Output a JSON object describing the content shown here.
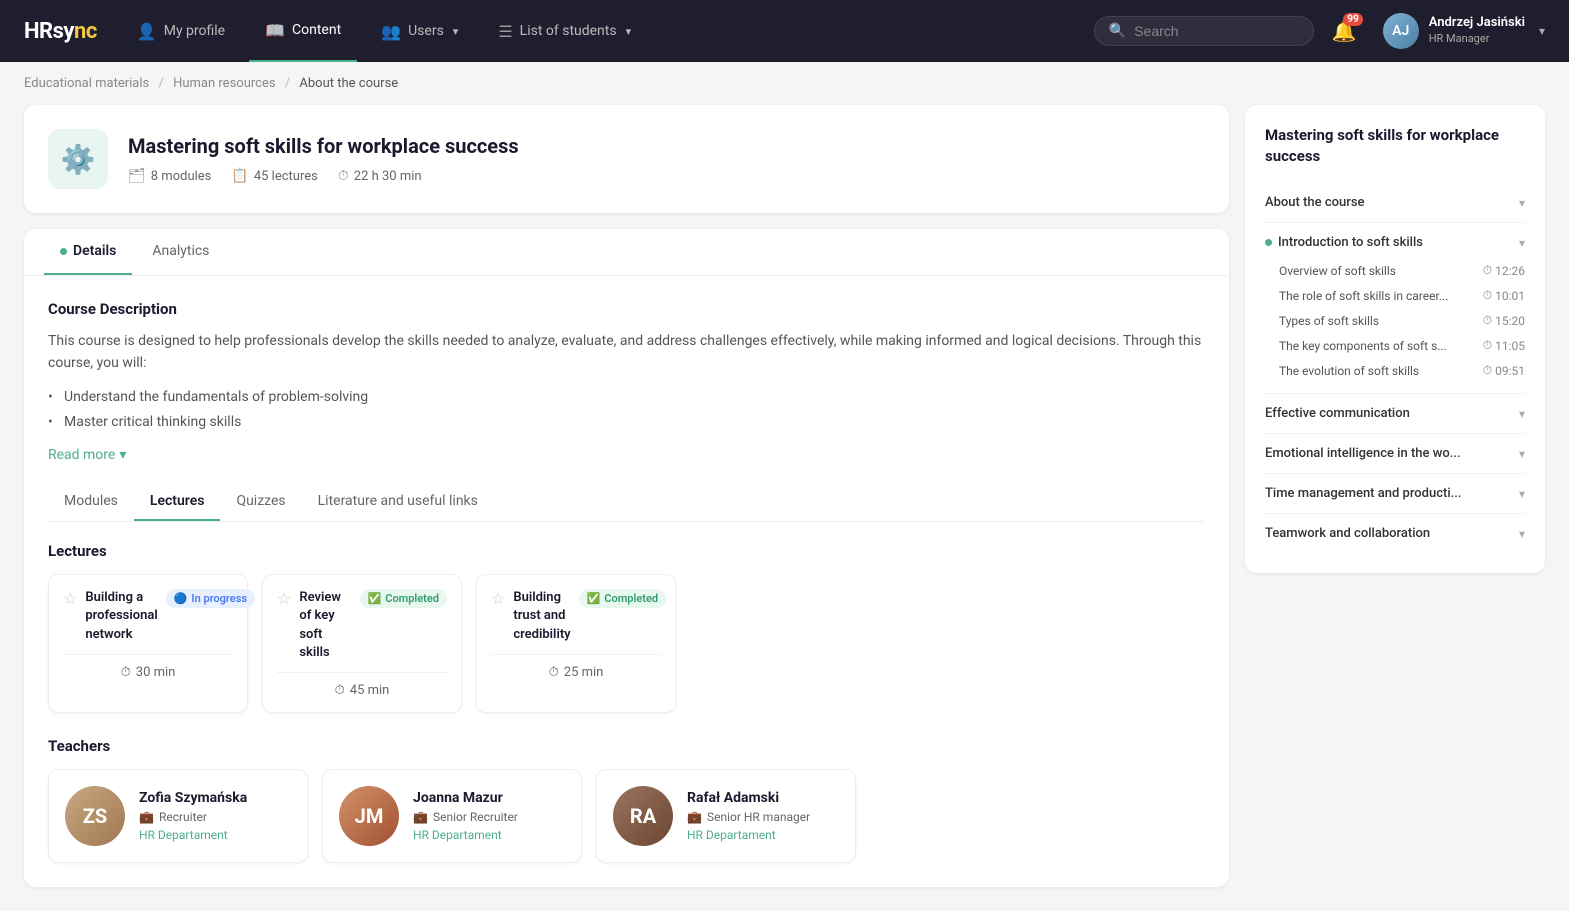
{
  "app": {
    "logo_text": "HRsy",
    "logo_accent": "nc"
  },
  "navbar": {
    "items": [
      {
        "id": "my-profile",
        "label": "My profile",
        "icon": "👤",
        "active": false
      },
      {
        "id": "content",
        "label": "Content",
        "icon": "📖",
        "active": true
      },
      {
        "id": "users",
        "label": "Users",
        "icon": "👥",
        "active": false,
        "has_dropdown": true
      },
      {
        "id": "list-of-students",
        "label": "List of students",
        "icon": "☰",
        "active": false,
        "has_dropdown": true
      }
    ],
    "search_placeholder": "Search",
    "notification_count": "99",
    "user": {
      "name": "Andrzej Jasiński",
      "role": "HR Manager"
    }
  },
  "breadcrumb": {
    "items": [
      {
        "label": "Educational materials"
      },
      {
        "label": "Human resources"
      },
      {
        "label": "About the course"
      }
    ]
  },
  "course": {
    "icon": "⚙️",
    "title": "Mastering soft skills for workplace success",
    "modules": "8 modules",
    "lectures": "45 lectures",
    "duration": "22 h 30 min"
  },
  "tabs": {
    "items": [
      {
        "id": "details",
        "label": "Details",
        "active": true,
        "has_dot": true
      },
      {
        "id": "analytics",
        "label": "Analytics",
        "active": false,
        "has_dot": false
      }
    ]
  },
  "description": {
    "section_title": "Course Description",
    "text": "This course is designed to help professionals develop the skills needed to analyze, evaluate, and address challenges effectively, while making informed and logical decisions. Through this course, you will:",
    "bullets": [
      "Understand the fundamentals of problem-solving",
      "Master critical thinking skills"
    ],
    "read_more_label": "Read more"
  },
  "sub_tabs": {
    "items": [
      {
        "id": "modules",
        "label": "Modules",
        "active": false
      },
      {
        "id": "lectures",
        "label": "Lectures",
        "active": true
      },
      {
        "id": "quizzes",
        "label": "Quizzes",
        "active": false
      },
      {
        "id": "literature",
        "label": "Literature and useful links",
        "active": false
      }
    ]
  },
  "lectures_section": {
    "title": "Lectures",
    "items": [
      {
        "id": "lec1",
        "name": "Building a professional network",
        "badge_label": "In progress",
        "badge_type": "inprogress",
        "badge_icon": "🔵",
        "time": "30 min"
      },
      {
        "id": "lec2",
        "name": "Review of key soft skills",
        "badge_label": "Completed",
        "badge_type": "completed",
        "badge_icon": "✅",
        "time": "45 min"
      },
      {
        "id": "lec3",
        "name": "Building trust and credibility",
        "badge_label": "Completed",
        "badge_type": "completed",
        "badge_icon": "✅",
        "time": "25 min"
      }
    ]
  },
  "teachers_section": {
    "title": "Teachers",
    "items": [
      {
        "id": "t1",
        "name": "Zofia Szymańska",
        "role": "Recruiter",
        "dept": "HR Departament",
        "avatar_type": "f1",
        "initials": "ZS"
      },
      {
        "id": "t2",
        "name": "Joanna Mazur",
        "role": "Senior Recruiter",
        "dept": "HR Departament",
        "avatar_type": "f2",
        "initials": "JM"
      },
      {
        "id": "t3",
        "name": "Rafał Adamski",
        "role": "Senior HR manager",
        "dept": "HR Departament",
        "avatar_type": "m1",
        "initials": "RA"
      }
    ]
  },
  "sidebar": {
    "title": "Mastering soft skills for workplace success",
    "sections": [
      {
        "id": "about",
        "label": "About the course",
        "has_bullet": false,
        "expanded": false,
        "lessons": []
      },
      {
        "id": "intro",
        "label": "Introduction to soft skills",
        "has_bullet": true,
        "expanded": true,
        "lessons": [
          {
            "name": "Overview of soft skills",
            "time": "12:26"
          },
          {
            "name": "The role of soft skills in career...",
            "time": "10:01"
          },
          {
            "name": "Types of soft skills",
            "time": "15:20"
          },
          {
            "name": "The key components of soft s...",
            "time": "11:05"
          },
          {
            "name": "The evolution of soft skills",
            "time": "09:51"
          }
        ]
      },
      {
        "id": "effective-comm",
        "label": "Effective communication",
        "has_bullet": false,
        "expanded": false,
        "lessons": []
      },
      {
        "id": "emotional-intel",
        "label": "Emotional intelligence in the wo...",
        "has_bullet": false,
        "expanded": false,
        "lessons": []
      },
      {
        "id": "time-mgmt",
        "label": "Time management and producti...",
        "has_bullet": false,
        "expanded": false,
        "lessons": []
      },
      {
        "id": "teamwork",
        "label": "Teamwork and collaboration",
        "has_bullet": false,
        "expanded": false,
        "lessons": []
      }
    ]
  }
}
